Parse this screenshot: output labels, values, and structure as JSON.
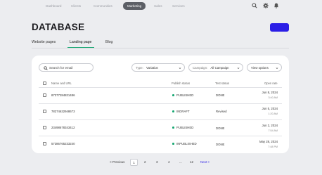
{
  "nav": {
    "items": [
      "Dashboard",
      "Clients",
      "Communities",
      "Marketing",
      "Sales",
      "Services"
    ],
    "active_index": 3
  },
  "icons": {
    "search": "search-icon",
    "settings": "gear-icon",
    "notifications": "bell-icon"
  },
  "page": {
    "title": "DATABASE"
  },
  "colors": {
    "accent": "#2b1ee6",
    "success": "#19a873",
    "background": "#ecedf0"
  },
  "tabs": [
    "Website pages",
    "Landing page",
    "Blog"
  ],
  "active_tab": 1,
  "toolbar": {
    "search_placeholder": "Search for email",
    "type_label": "Type:",
    "type_value": "Variation",
    "campaign_label": "Campaign:",
    "campaign_value": "All Campaign",
    "view_options": "View options"
  },
  "table": {
    "columns": [
      "Name and URL",
      "Publish status",
      "Test status",
      "Open rate"
    ],
    "rows": [
      {
        "name": "87377284821486",
        "publish": "PUBLISHED",
        "test": "DONE",
        "date": "Jun 8, 2024",
        "time": "3:40 AM"
      },
      {
        "name": "78274632948673",
        "publish": "INDRAFT",
        "test": "Revised",
        "date": "Jun 5, 2024",
        "time": "1:20 AM"
      },
      {
        "name": "23498678343412",
        "publish": "PUBLISHED",
        "test": "DONE",
        "date": "Jun 2, 2024",
        "time": "7:54 AM"
      },
      {
        "name": "57386765233240",
        "publish": "INPUBLISHED",
        "test": "DONE",
        "date": "May 28, 2024",
        "time": "7:48 PM"
      }
    ]
  },
  "pagination": {
    "previous": "< Previous",
    "pages": [
      "1",
      "2",
      "3",
      "4",
      "...",
      "12"
    ],
    "current": "1",
    "next": "Next >"
  }
}
